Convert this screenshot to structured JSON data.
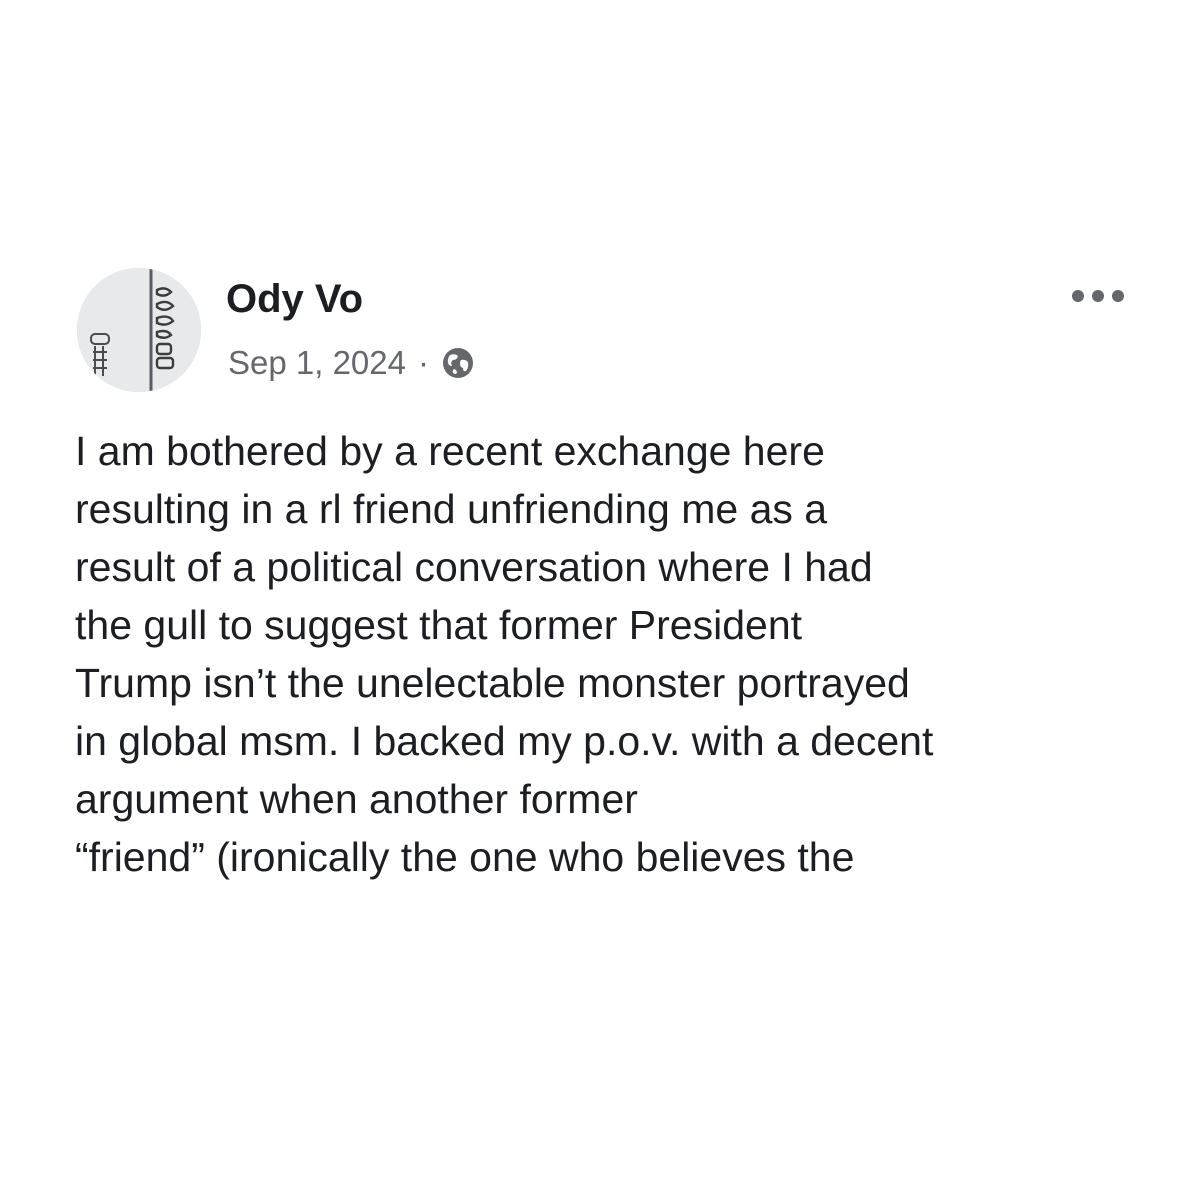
{
  "post": {
    "author": "Ody Vo",
    "date": "Sep 1, 2024",
    "separator": "·",
    "privacy_icon": "globe-icon",
    "more_icon": "more-horizontal-icon",
    "body_lines": [
      "I am bothered by a recent exchange here",
      "resulting in a rl friend unfriending me as a",
      "result of a political conversation where I had",
      "the gull to suggest that former President",
      "Trump isn’t the unelectable monster portrayed",
      "in global msm. I backed my p.o.v. with a decent",
      "argument when another former",
      "“friend” (ironically the one who believes the"
    ]
  },
  "colors": {
    "text": "#1c1e21",
    "secondary_text": "#65676b",
    "background": "#ffffff"
  }
}
